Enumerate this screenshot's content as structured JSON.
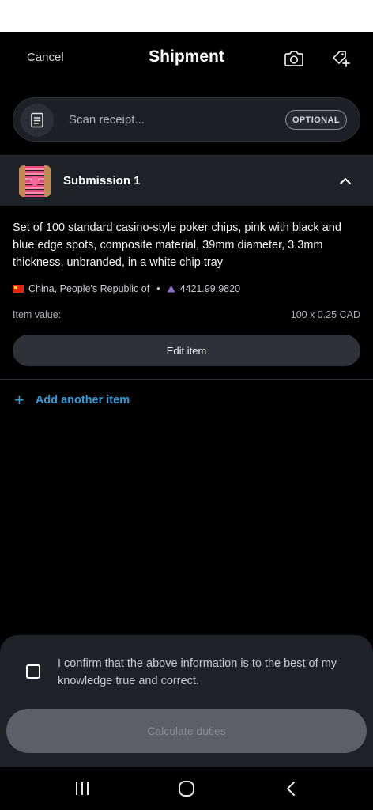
{
  "header": {
    "cancel_label": "Cancel",
    "title": "Shipment",
    "camera_icon": "camera-icon",
    "tag_icon": "tag-add-icon"
  },
  "scan": {
    "icon": "receipt-icon",
    "placeholder": "Scan receipt...",
    "badge": "OPTIONAL"
  },
  "submission": {
    "title": "Submission 1",
    "toggle_icon": "chevron-up-icon",
    "item": {
      "description": "Set of 100 standard casino-style poker chips, pink with black and blue edge spots, composite material, 39mm diameter, 3.3mm thickness, unbranded, in a white chip tray",
      "origin": "China, People's Republic of",
      "separator": "•",
      "hs_code": "4421.99.9820",
      "value_label": "Item value:",
      "value_amount": "100 x 0.25 CAD",
      "edit_label": "Edit item"
    }
  },
  "add_item": {
    "icon": "+",
    "label": "Add another item"
  },
  "footer": {
    "confirm_text": "I confirm that the above information is to the best of my knowledge true and correct.",
    "checked": false,
    "calculate_label": "Calculate duties"
  },
  "nav": {
    "recents_icon": "recents-icon",
    "home_icon": "home-icon",
    "back_icon": "back-icon"
  },
  "colors": {
    "background": "#000000",
    "surface": "#1e2227",
    "accent": "#2e9ddb",
    "disabled_button": "#5c6066"
  }
}
